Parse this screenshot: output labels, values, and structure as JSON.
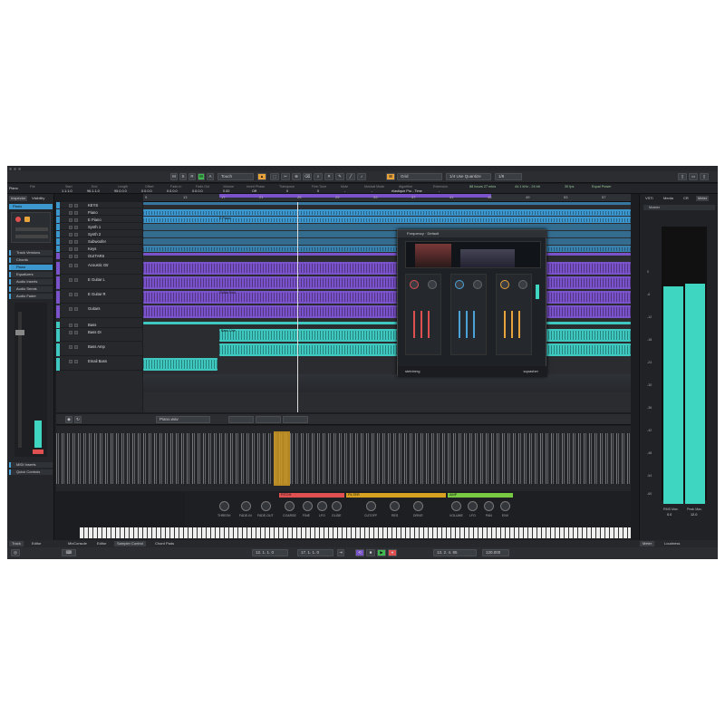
{
  "toolbar": {
    "mode_buttons": [
      "M",
      "S",
      "R",
      "W",
      "A"
    ],
    "automation_mode": "Touch",
    "grid_type": "Grid",
    "quantize_mode": "1/4 Use Quantize",
    "quantize_value": "1/8"
  },
  "infoline": {
    "track": "Piano",
    "fields": [
      {
        "label": "File",
        "value": ""
      },
      {
        "label": "Start",
        "value": "1.1.1.0"
      },
      {
        "label": "End",
        "value": "96.1.1.0"
      },
      {
        "label": "Length",
        "value": "95.0.0.0"
      },
      {
        "label": "Offset",
        "value": "0.0.0.0"
      },
      {
        "label": "Fade-In",
        "value": "0.0.0.0"
      },
      {
        "label": "Fade-Out",
        "value": "0.0.0.0"
      },
      {
        "label": "Volume",
        "value": "0.00"
      },
      {
        "label": "Invert Phase",
        "value": "Off"
      },
      {
        "label": "Transpose",
        "value": "0"
      },
      {
        "label": "Fine-Tune",
        "value": "0"
      },
      {
        "label": "Mute",
        "value": "-"
      },
      {
        "label": "Musical Mode",
        "value": "-"
      },
      {
        "label": "Algorithm",
        "value": "élastique Pro - Time"
      },
      {
        "label": "Extension",
        "value": "-"
      }
    ],
    "status": {
      "audio_inputs": "Connected",
      "audio_outputs": "Connected",
      "max_record_time": "88 hours 27 mins",
      "record_format": "44.1 kHz - 24 bit",
      "frame_rate": "30 fps",
      "pan_law": "Equal Power"
    }
  },
  "inspector": {
    "tabs": [
      "Inspector",
      "Visibility"
    ],
    "track_name": "Piano",
    "sections": [
      "Track Versions",
      "Chords",
      "Piano",
      "Equalizers",
      "Audio Inserts",
      "Audio Sends",
      "Audio Fader",
      "MIDI Inserts",
      "Quick Controls"
    ]
  },
  "tracks": [
    {
      "name": "KEYS",
      "color": "#3c97cf"
    },
    {
      "name": "Piano",
      "color": "#3c97cf"
    },
    {
      "name": "E Piano",
      "color": "#3c97cf"
    },
    {
      "name": "Synth 1",
      "color": "#3c97cf"
    },
    {
      "name": "Synth 2",
      "color": "#3c97cf"
    },
    {
      "name": "Subwoofer",
      "color": "#3c97cf"
    },
    {
      "name": "Keys",
      "color": "#3c97cf"
    },
    {
      "name": "GUITARS",
      "color": "#7a52c9"
    },
    {
      "name": "Acoustic Gtr",
      "color": "#7a52c9"
    },
    {
      "name": "E Guitar L",
      "color": "#7a52c9"
    },
    {
      "name": "E Guitar R",
      "color": "#7a52c9"
    },
    {
      "name": "Guitars",
      "color": "#7a52c9"
    },
    {
      "name": "Bass",
      "color": "#3ec8c0"
    },
    {
      "name": "Bass DI",
      "color": "#3ec8c0"
    },
    {
      "name": "Bass Amp",
      "color": "#3ec8c0"
    },
    {
      "name": "Email Bass",
      "color": "#3ec8c0"
    }
  ],
  "ruler": [
    "9",
    "13",
    "17",
    "21",
    "25",
    "29",
    "33",
    "37",
    "41",
    "45",
    "49",
    "53",
    "57"
  ],
  "clips": {
    "epiano": "E Piano",
    "guitar": "Guitar Solo",
    "bass": "Bass Line"
  },
  "plugin": {
    "title": "Frequency",
    "preset": "Default",
    "brand": "steinberg",
    "name": "squasher"
  },
  "mixer": {
    "tabs": [
      "VSTi",
      "Media",
      "CR",
      "Meter"
    ],
    "header": "Master",
    "scale": [
      "0",
      "-6",
      "-12",
      "-18",
      "-24",
      "-30",
      "-36",
      "-42",
      "-48",
      "-54",
      "-60"
    ],
    "rms_label": "RMS Max.",
    "rms_value": "0.0",
    "peak_label": "Peak Max.",
    "peak_value": "12.0"
  },
  "editor": {
    "event_name": "Piano.wav",
    "sections": [
      {
        "name": "PITCH",
        "color": "#e05050",
        "knobs": [
          "FINE",
          "LFO",
          "GLIDE"
        ]
      },
      {
        "name": "FILTER",
        "color": "#d8a020",
        "knobs": [
          "CUTOFF",
          "RES",
          "DRIVE"
        ]
      },
      {
        "name": "AMP",
        "color": "#7ac943",
        "knobs": [
          "VOLUME",
          "LFO",
          "PAN",
          "ENV"
        ]
      }
    ],
    "left_knobs": [
      "THRESH",
      "FADE-IN",
      "FADE-OUT",
      "COARSE"
    ]
  },
  "bottom_tabs": [
    "Track",
    "Editor",
    "MixConsole",
    "Editor",
    "Sampler Control",
    "Chord Pads"
  ],
  "right_tabs": [
    "Meter",
    "Loudness"
  ],
  "transport": {
    "left_pos": "12. 1. 1. 0",
    "right_pos": "17. 1. 1. 0",
    "position": "13. 2. 4. 85",
    "tempo": "120.000"
  }
}
